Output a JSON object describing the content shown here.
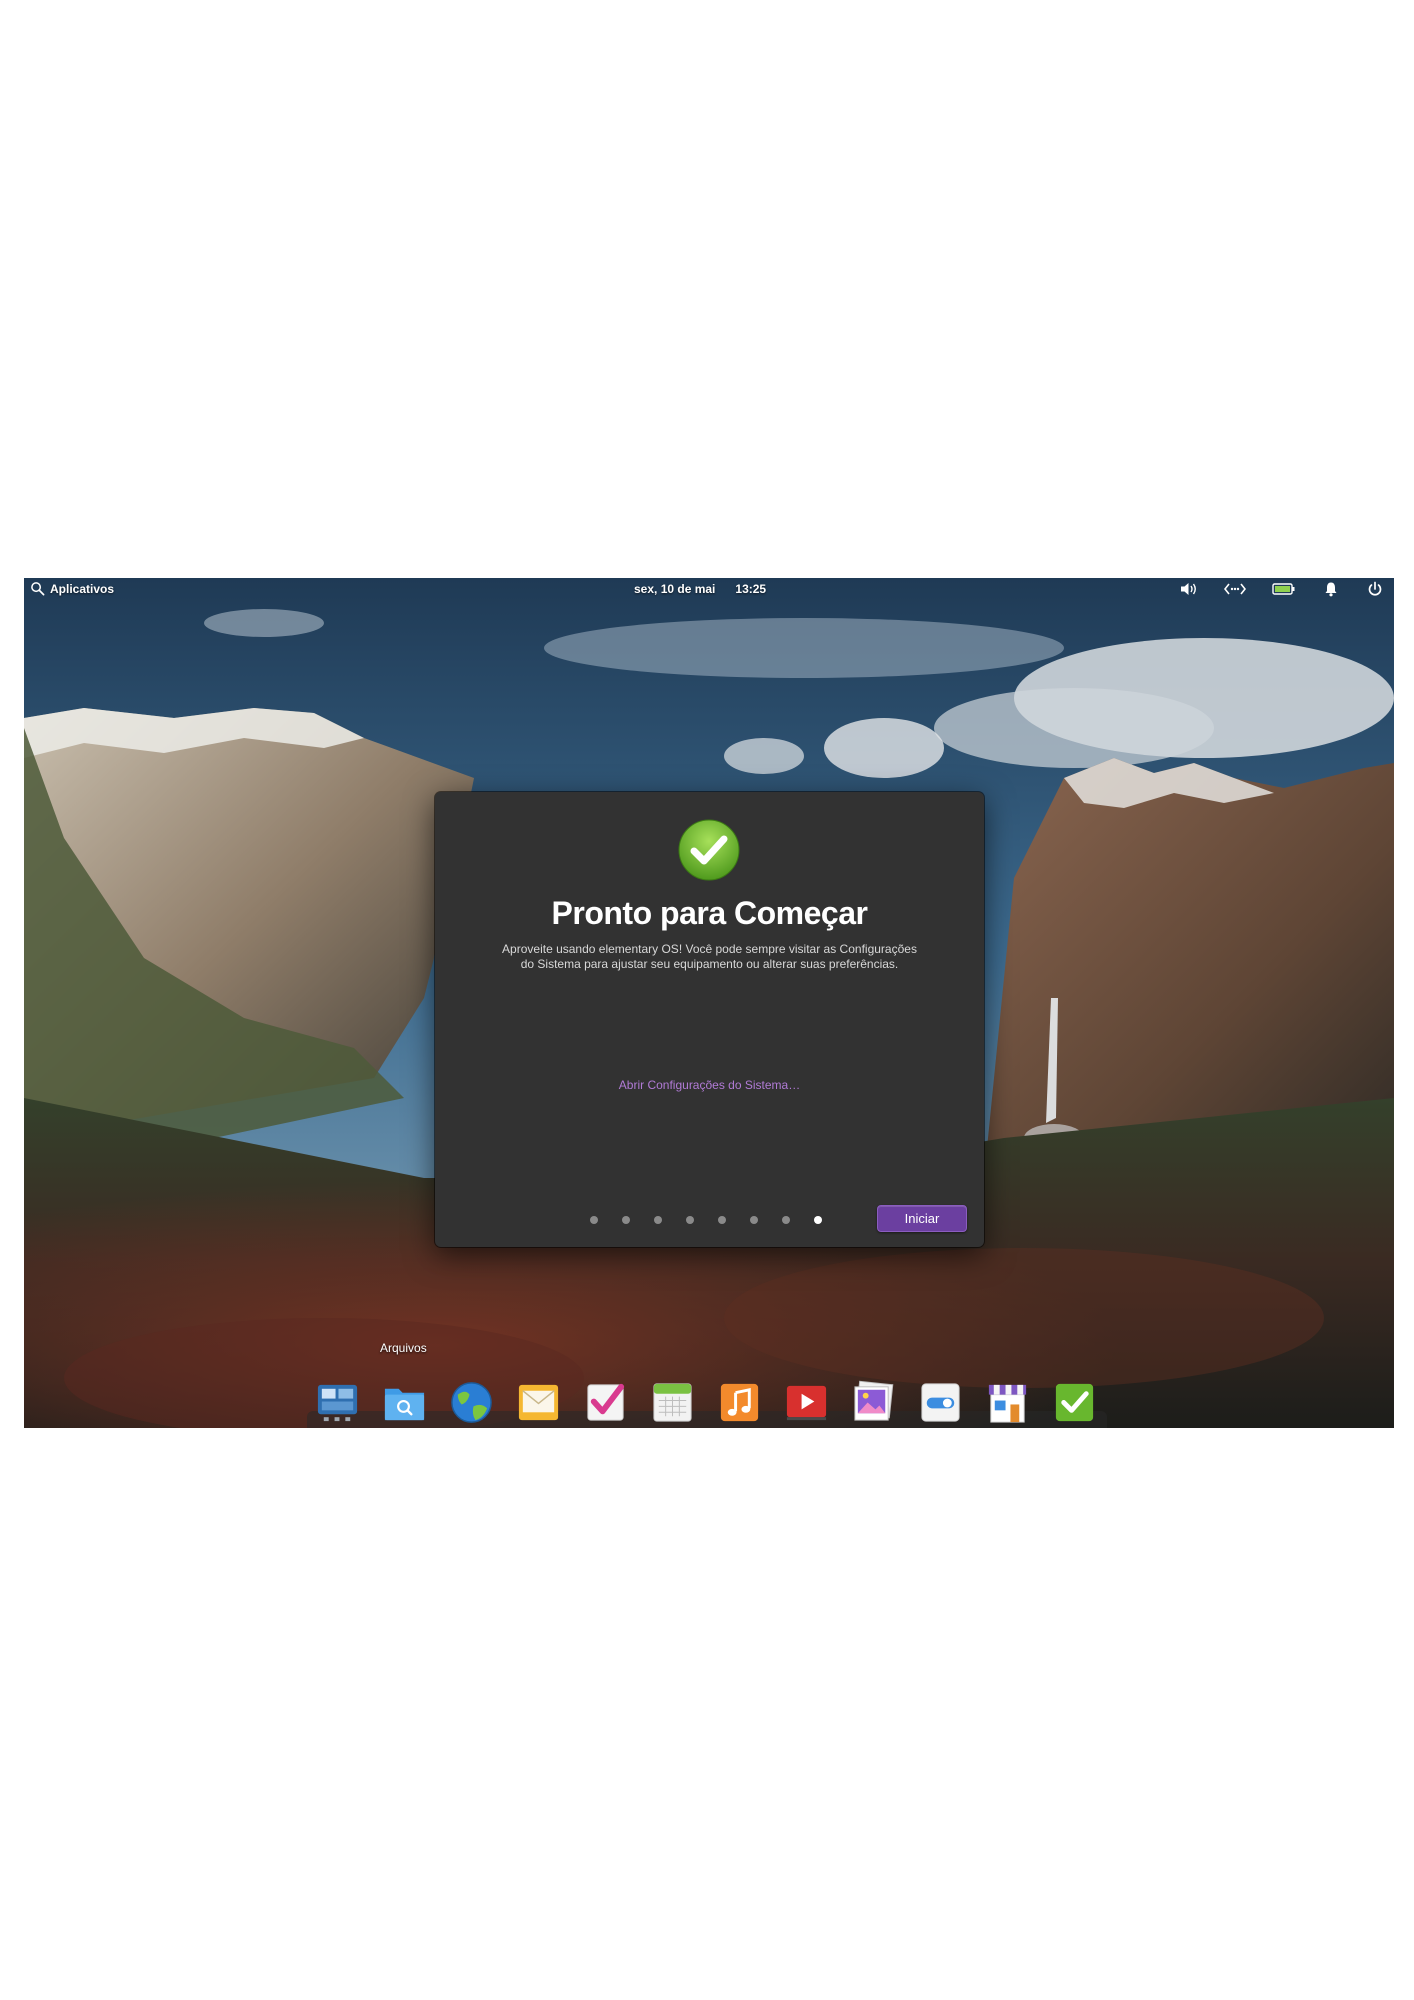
{
  "panel": {
    "apps_label": "Aplicativos",
    "date": "sex, 10 de mai",
    "time": "13:25",
    "tray_icons": [
      "volume-icon",
      "network-icon",
      "battery-icon",
      "notifications-icon",
      "power-icon"
    ]
  },
  "dialog": {
    "icon": "check-icon",
    "title": "Pronto para Começar",
    "description_line1": "Aproveite usando elementary OS! Você pode sempre visitar as Configurações",
    "description_line2": "do Sistema para ajustar seu equipamento ou alterar suas preferências.",
    "settings_link": "Abrir Configurações do Sistema…",
    "page_count": 8,
    "active_page": 8,
    "start_button": "Iniciar",
    "colors": {
      "background": "#323232",
      "accent_button": "#6b3fa0",
      "link": "#b17bd6"
    }
  },
  "dock": {
    "tooltip": "Arquivos",
    "apps": [
      "multitasking-view-icon",
      "files-icon",
      "web-browser-icon",
      "mail-icon",
      "tasks-icon",
      "calendar-icon",
      "music-icon",
      "videos-icon",
      "photos-icon",
      "system-settings-icon",
      "appcenter-icon",
      "initial-setup-icon"
    ]
  }
}
